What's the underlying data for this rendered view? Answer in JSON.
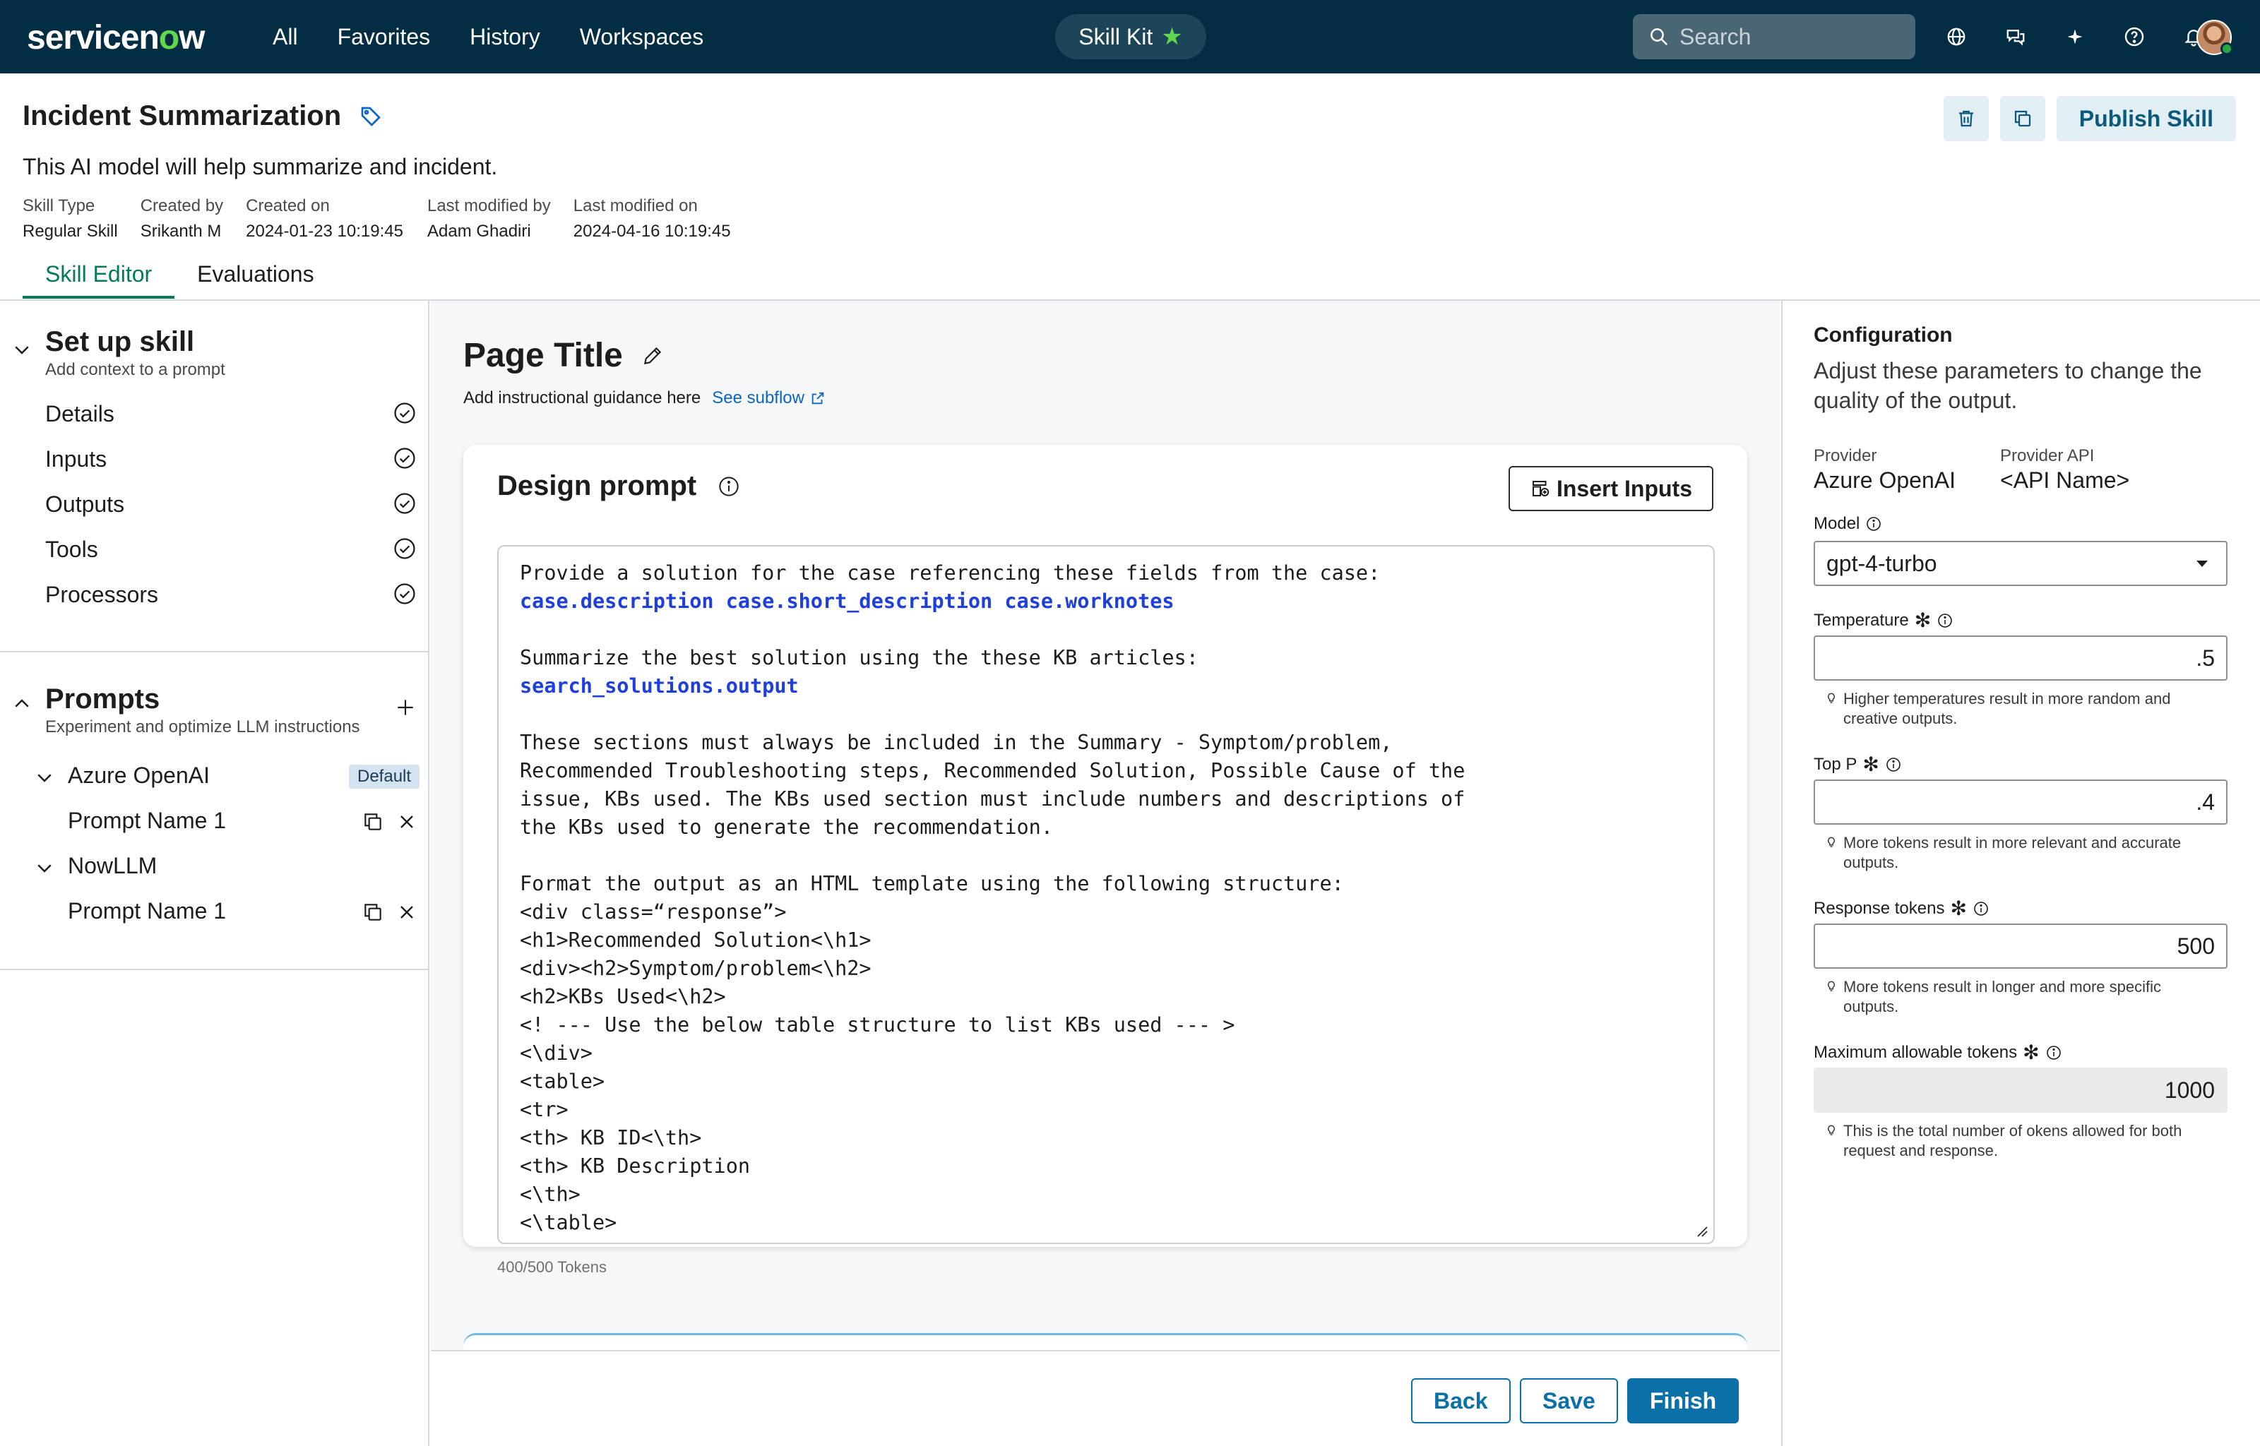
{
  "nav": {
    "logo_pre": "servicen",
    "logo_o": "o",
    "logo_post": "w",
    "links": [
      "All",
      "Favorites",
      "History",
      "Workspaces"
    ],
    "center_pill": "Skill Kit",
    "search_placeholder": "Search",
    "icons": [
      "globe-icon",
      "chat-icon",
      "sparkle-icon",
      "help-icon",
      "bell-icon"
    ]
  },
  "header": {
    "title": "Incident Summarization",
    "description": "This AI model will help summarize and incident.",
    "meta": [
      {
        "label": "Skill Type",
        "value": "Regular Skill"
      },
      {
        "label": "Created by",
        "value": "Srikanth M"
      },
      {
        "label": "Created on",
        "value": "2024-01-23 10:19:45"
      },
      {
        "label": "Last modified by",
        "value": "Adam Ghadiri"
      },
      {
        "label": "Last modified on",
        "value": "2024-04-16 10:19:45"
      }
    ],
    "publish_label": "Publish Skill",
    "tabs": [
      "Skill Editor",
      "Evaluations"
    ]
  },
  "sidebar": {
    "setup": {
      "title": "Set up skill",
      "subtitle": "Add context to a prompt",
      "items": [
        "Details",
        "Inputs",
        "Outputs",
        "Tools",
        "Processors"
      ]
    },
    "prompts": {
      "title": "Prompts",
      "subtitle": "Experiment and optimize LLM instructions",
      "groups": [
        {
          "name": "Azure OpenAI",
          "badge": "Default",
          "prompt": "Prompt Name 1"
        },
        {
          "name": "NowLLM",
          "badge": "",
          "prompt": "Prompt Name 1"
        }
      ]
    }
  },
  "main": {
    "page_title": "Page Title",
    "guidance": "Add instructional guidance here",
    "subflow_link": "See subflow",
    "card_title": "Design prompt",
    "insert_label": "Insert Inputs",
    "prompt": {
      "l1": "Provide a solution for the case referencing these fields from the case:",
      "l2": "case.description case.short_description case.worknotes",
      "l3": "Summarize the best solution using the these KB articles:",
      "l4": "search_solutions.output",
      "l5": "These sections must always be included in the Summary - Symptom/problem,",
      "l6": "Recommended Troubleshooting steps, Recommended Solution, Possible Cause of the",
      "l7": "issue, KBs used. The KBs used section must include numbers and descriptions of",
      "l8": "the KBs used to generate the recommendation.",
      "l9": "Format the output as an HTML template using the following structure:",
      "l10": "<div class=“response”>",
      "l11": "<h1>Recommended Solution<\\h1>",
      "l12": "<div><h2>Symptom/problem<\\h2>",
      "l13": "<h2>KBs Used<\\h2>",
      "l14": "<! --- Use the below table structure to list KBs used --- >",
      "l15": "<\\div>",
      "l16": "<table>",
      "l17": "<tr>",
      "l18": "<th> KB ID<\\th>",
      "l19": "<th> KB Description",
      "l20": "<\\th>",
      "l21": "<\\table>"
    },
    "tokens": "400/500 Tokens",
    "footer": {
      "back": "Back",
      "save": "Save",
      "finish": "Finish"
    }
  },
  "config": {
    "title": "Configuration",
    "description": "Adjust these parameters to change the quality of the output.",
    "provider_label": "Provider",
    "provider_value": "Azure OpenAI",
    "api_label": "Provider API",
    "api_value": "<API Name>",
    "model_label": "Model",
    "model_value": "gpt-4-turbo",
    "temperature_label": "Temperature",
    "temperature_value": ".5",
    "temperature_hint": "Higher temperatures result in more random and creative outputs.",
    "topp_label": "Top P",
    "topp_value": ".4",
    "topp_hint": "More tokens result in more relevant and accurate outputs.",
    "resp_label": "Response tokens",
    "resp_value": "500",
    "resp_hint": "More tokens result in longer and more specific outputs.",
    "max_label": "Maximum allowable tokens",
    "max_value": "1000",
    "max_hint": "This is the total number of okens allowed for both request and response."
  }
}
